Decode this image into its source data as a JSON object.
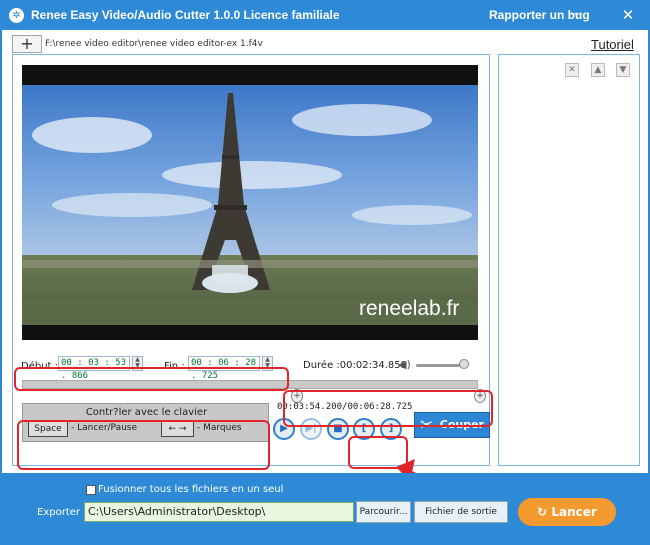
{
  "titlebar": {
    "title": "Renee Easy Video/Audio Cutter 1.0.0 Licence familiale",
    "bug_label": "Rapporter un bug"
  },
  "toolbar": {
    "add_label": "+",
    "file_path": "F:\\renee video editor\\renee video editor-ex 1.f4v",
    "tutorial_label": "Tutoriel"
  },
  "video": {
    "watermark": "reneelab.fr"
  },
  "trim": {
    "start_label": "Début :",
    "start_value": "00 : 03 : 53 . 866",
    "end_label": "Fin :",
    "end_value": "00 : 06 : 28 . 725",
    "duration_label": "Durée :00:02:34.859",
    "volume_level": 0.85,
    "range_start_fraction": 0.61,
    "range_end_fraction": 1.0
  },
  "keyboard": {
    "title": "Contr?ler avec le clavier",
    "space_key": "Space",
    "space_desc": "- Lancer/Pause",
    "arrow_keys": "← →",
    "arrow_desc": "- Marques"
  },
  "playback": {
    "time_info": "00:03:54.200/00:06:28.725",
    "cut_label": "Couper"
  },
  "bottom": {
    "merge_label": "Fusionner tous les fichiers en un seul",
    "export_label": "Exporter :",
    "export_path": "C:\\Users\\Administrator\\Desktop\\",
    "browse_label": "Parcourir...",
    "output_label": "Fichier de sortie",
    "start_label": "Lancer"
  },
  "colors": {
    "accent": "#2e8ad6",
    "highlight": "#e0262b",
    "start_button": "#f59a2f"
  }
}
